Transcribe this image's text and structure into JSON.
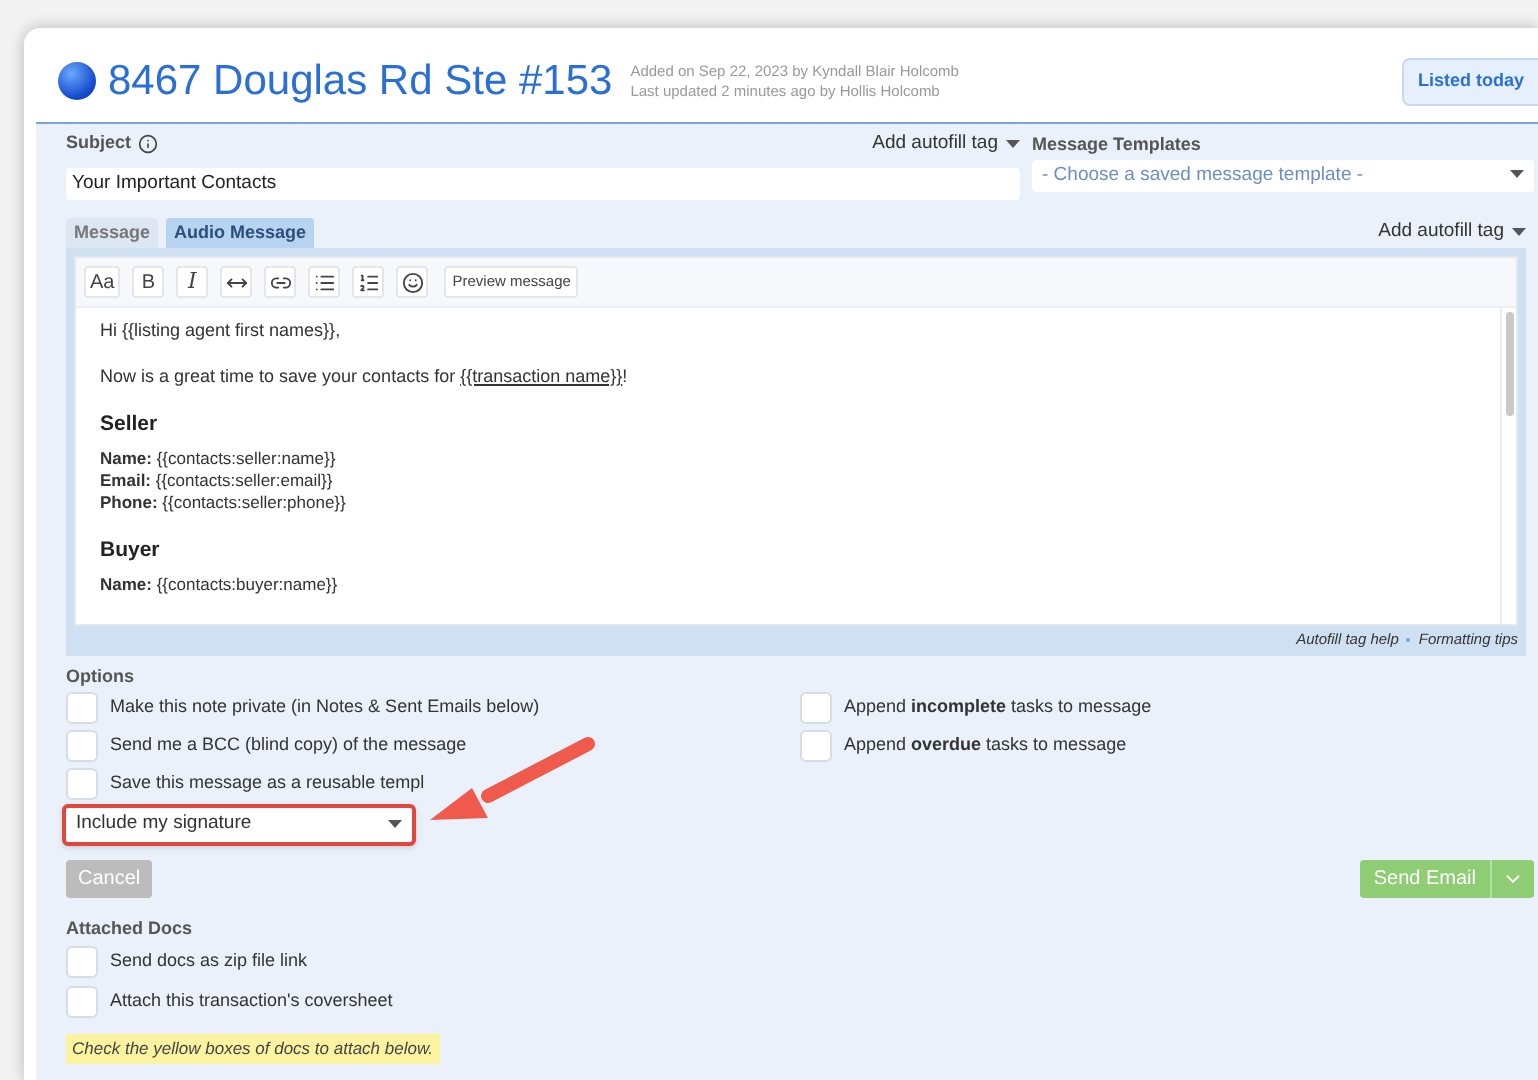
{
  "header": {
    "title": "8467 Douglas Rd Ste #153",
    "added": "Added on Sep 22, 2023 by Kyndall Blair Holcomb",
    "updated": "Last updated 2 minutes ago by Hollis Holcomb",
    "status_button": "Listed today"
  },
  "subject": {
    "label": "Subject",
    "value": "Your Important Contacts",
    "autofill": "Add autofill tag"
  },
  "templates": {
    "label": "Message Templates",
    "placeholder": "- Choose a saved message template -"
  },
  "tabs": [
    {
      "label": "Message",
      "selected": false
    },
    {
      "label": "Audio Message",
      "selected": true
    }
  ],
  "editor": {
    "autofill": "Add autofill tag",
    "toolbar": [
      {
        "kind": "font",
        "label": "Aa"
      },
      {
        "kind": "bold",
        "label": "B"
      },
      {
        "kind": "italic",
        "label": "I"
      },
      {
        "kind": "rule"
      },
      {
        "kind": "link"
      },
      {
        "kind": "bullets"
      },
      {
        "kind": "numbers"
      },
      {
        "kind": "emoji"
      },
      {
        "kind": "preview",
        "label": "Preview message"
      }
    ],
    "content": [
      {
        "kind": "p",
        "text": "Hi {{listing agent first names}},"
      },
      {
        "kind": "p",
        "text": "Now is a great time to save your contacts for ",
        "tag": "{{transaction name}}",
        "after": "!"
      },
      {
        "kind": "h",
        "text": "Seller"
      },
      {
        "kind": "lines",
        "lines": [
          "**Name:** {{contacts:seller:name}}",
          "**Email:** {{contacts:seller:email}}",
          "**Phone:** {{contacts:seller:phone}}"
        ]
      },
      {
        "kind": "h",
        "text": "Buyer"
      },
      {
        "kind": "lines",
        "lines": [
          "**Name:** {{contacts:buyer:name}}"
        ]
      }
    ],
    "help_links": [
      "Autofill tag help",
      "Formatting tips"
    ]
  },
  "options": {
    "label": "Options",
    "left": [
      {
        "label": "Make this note private (in Notes & Sent Emails below)",
        "checked": false
      },
      {
        "label": "Send me a BCC (blind copy) of the message",
        "checked": false
      },
      {
        "label": "Save this message as a reusable templ",
        "checked": false
      }
    ],
    "right": [
      {
        "label": "Append **incomplete** tasks to message",
        "checked": false
      },
      {
        "label": "Append **overdue** tasks to message",
        "checked": false
      }
    ],
    "signature": "Include my signature"
  },
  "buttons": {
    "cancel": "Cancel",
    "send": "Send Email"
  },
  "attached": {
    "label": "Attached Docs",
    "items": [
      {
        "label": "Send docs as zip file link",
        "checked": false
      },
      {
        "label": "Attach this transaction's coversheet",
        "checked": false
      }
    ],
    "note": "Check the yellow boxes of docs to attach below."
  }
}
